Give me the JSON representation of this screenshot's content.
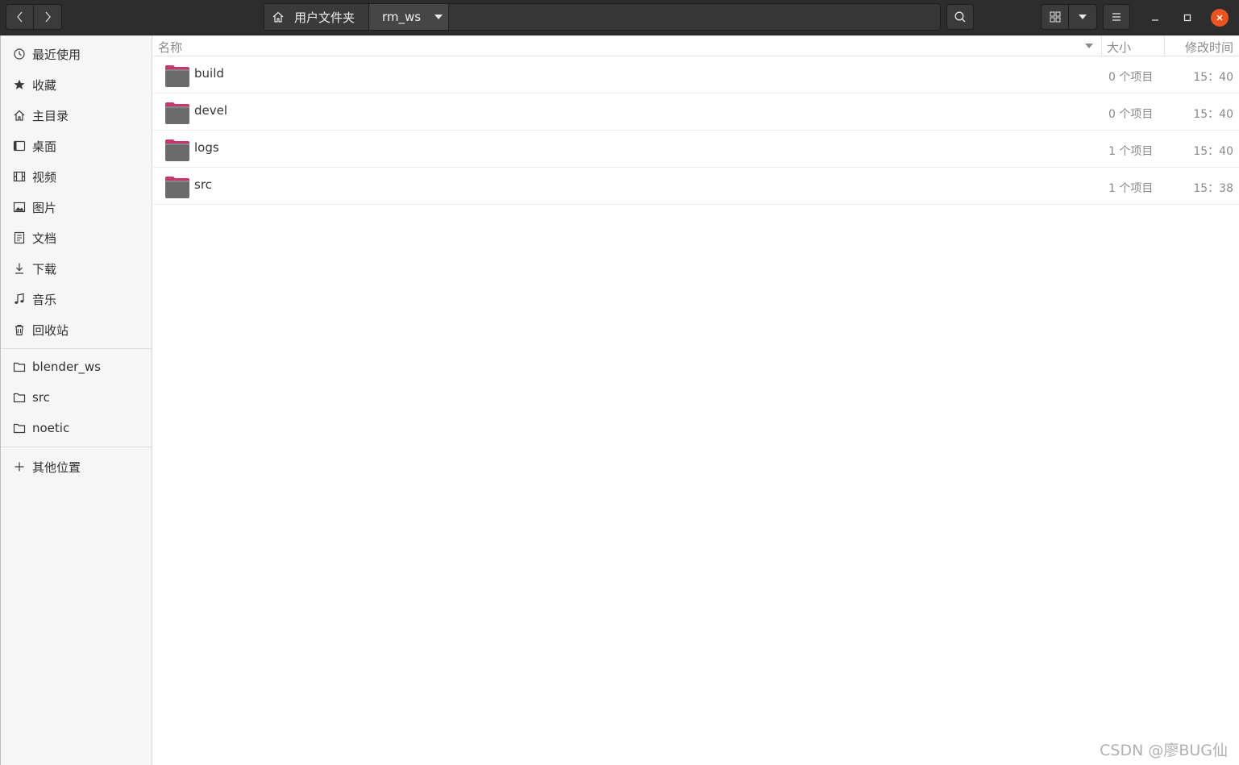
{
  "pathbar": {
    "home_label": "用户文件夹",
    "current_label": "rm_ws"
  },
  "sidebar": {
    "places": [
      {
        "label": "最近使用",
        "icon": "clock-icon"
      },
      {
        "label": "收藏",
        "icon": "star-icon"
      },
      {
        "label": "主目录",
        "icon": "home-icon"
      },
      {
        "label": "桌面",
        "icon": "desktop-icon"
      },
      {
        "label": "视频",
        "icon": "film-icon"
      },
      {
        "label": "图片",
        "icon": "image-icon"
      },
      {
        "label": "文档",
        "icon": "document-icon"
      },
      {
        "label": "下载",
        "icon": "download-icon"
      },
      {
        "label": "音乐",
        "icon": "music-icon"
      },
      {
        "label": "回收站",
        "icon": "trash-icon"
      }
    ],
    "bookmarks": [
      {
        "label": "blender_ws",
        "icon": "folder-icon"
      },
      {
        "label": "src",
        "icon": "folder-icon"
      },
      {
        "label": "noetic",
        "icon": "folder-icon"
      }
    ],
    "other": {
      "label": "其他位置",
      "icon": "plus-icon"
    }
  },
  "columns": {
    "name": "名称",
    "size": "大小",
    "modified": "修改时间"
  },
  "files": [
    {
      "name": "build",
      "size": "0 个项目",
      "modified": "15：40"
    },
    {
      "name": "devel",
      "size": "0 个项目",
      "modified": "15：40"
    },
    {
      "name": "logs",
      "size": "1 个项目",
      "modified": "15：40"
    },
    {
      "name": "src",
      "size": "1 个项目",
      "modified": "15：38"
    }
  ],
  "watermark": "CSDN @廖BUG仙",
  "colors": {
    "headerbar": "#2d2d2d",
    "close_button": "#e95420",
    "folder_body": "#6b6b6b",
    "folder_tab": "#c7366f"
  }
}
